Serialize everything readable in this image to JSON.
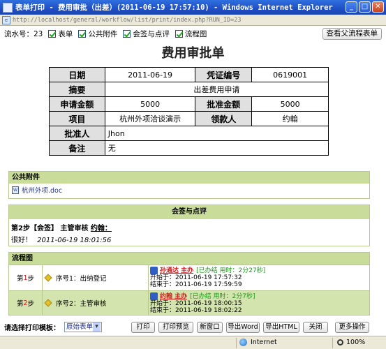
{
  "window": {
    "title": "表单打印 - 费用审批（出差）(2011-06-19 17:57:10) - Windows Internet Explorer",
    "controls": {
      "minimize": "_",
      "maximize": "□",
      "close": "✕"
    },
    "address": "http://localhost/general/workflow/list/print/index.php?RUN_ID=23"
  },
  "toolbar": {
    "flow_no_label": "流水号：23",
    "form_label": "表单",
    "attach_label": "公共附件",
    "sign_label": "会签与点评",
    "flowchart_label": "流程图",
    "parent_button": "查看父流程表单"
  },
  "form": {
    "title": "费用审批单",
    "rows": [
      {
        "label1": "日期",
        "value1": "2011-06-19",
        "label2": "凭证编号",
        "value2": "0619001"
      },
      {
        "label1": "摘要",
        "value1": "出差费用申请"
      },
      {
        "label1": "申请金额",
        "value1": "5000",
        "label2": "批准金额",
        "value2": "5000"
      },
      {
        "label1": "项目",
        "value1": "杭州外项洽谈演示",
        "label2": "领款人",
        "value2": "约翰"
      },
      {
        "label1": "批准人",
        "value1": "Jhon"
      },
      {
        "label1": "备注",
        "value1": "无"
      }
    ]
  },
  "attachments": {
    "header": "公共附件",
    "files": [
      {
        "name": "杭州外项.doc"
      }
    ]
  },
  "sign": {
    "header": "会签与点评",
    "step": "第2步【会签】 主管审核",
    "user": "约翰：",
    "comment": "很好！",
    "time": "2011-06-19 18:01:56"
  },
  "flow": {
    "header": "流程图",
    "steps": [
      {
        "step_prefix": "第",
        "step_num": "1",
        "step_suffix": "步",
        "name": "序号1：出纳登记",
        "user": "孙通达 主办",
        "state": "[已办结 用时：2分27秒]",
        "start": "开始于：2011-06-19 17:57:32",
        "end": "结束于：2011-06-19 17:59:59"
      },
      {
        "step_prefix": "第",
        "step_num": "2",
        "step_suffix": "步",
        "name": "序号2：主管审核",
        "user": "约翰 主办",
        "state": "[已办结 用时：2分7秒]",
        "start": "开始于：2011-06-19 18:00:15",
        "end": "结束于：2011-06-19 18:02:22"
      }
    ]
  },
  "bottom": {
    "template_label": "请选择打印模板：",
    "template_value": "原始表单",
    "buttons": [
      "打印",
      "打印预览",
      "新窗口",
      "导出Word",
      "导出HTML",
      "关闭",
      "更多操作"
    ]
  },
  "status": {
    "zone": "Internet",
    "zoom": "100%"
  }
}
